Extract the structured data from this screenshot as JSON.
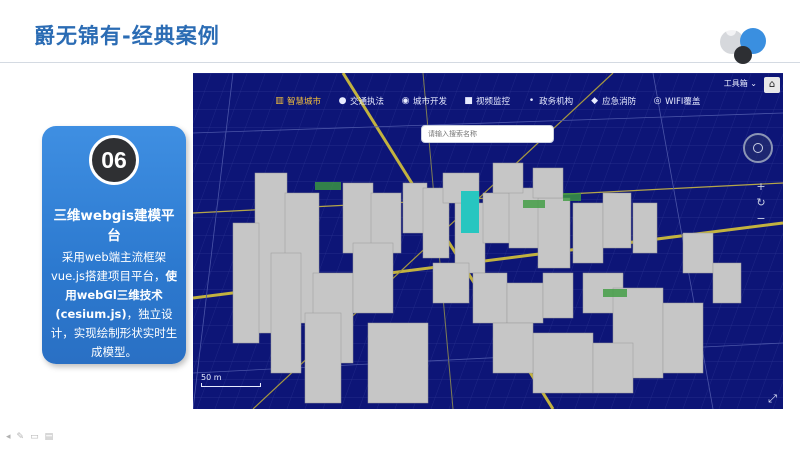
{
  "slide": {
    "title": "爵无锦有-经典案例",
    "colors": {
      "title": "#2b6cb4",
      "card": "#2f7ed6",
      "map_bg": "#0d1577",
      "building": "#c9c9c9",
      "highlight": "#27c6c0"
    }
  },
  "card": {
    "number": "06",
    "heading": "三维webgis建模平台",
    "body_1": "采用web端主流框架vue.js搭建项目平台，",
    "body_bold": "使用webGl三维技术(cesium.js)",
    "body_2": "，独立设计，实现绘制形状实时生成模型。"
  },
  "map": {
    "nav": [
      {
        "label": "智慧城市",
        "icon": "building-icon",
        "active": true
      },
      {
        "label": "交通执法",
        "icon": "person-icon",
        "active": false
      },
      {
        "label": "城市开发",
        "icon": "pin-icon",
        "active": false
      },
      {
        "label": "视频监控",
        "icon": "camera-icon",
        "active": false
      },
      {
        "label": "政务机构",
        "icon": "dot-icon",
        "active": false
      },
      {
        "label": "应急消防",
        "icon": "alert-icon",
        "active": false
      },
      {
        "label": "WIFI覆盖",
        "icon": "wifi-icon",
        "active": false
      }
    ],
    "tool_menu": "工具箱",
    "search_placeholder": "请输入搜索名称",
    "scale_label": "50 m"
  },
  "bottom_tools": [
    "◂",
    "✎",
    "▭",
    "▤"
  ]
}
